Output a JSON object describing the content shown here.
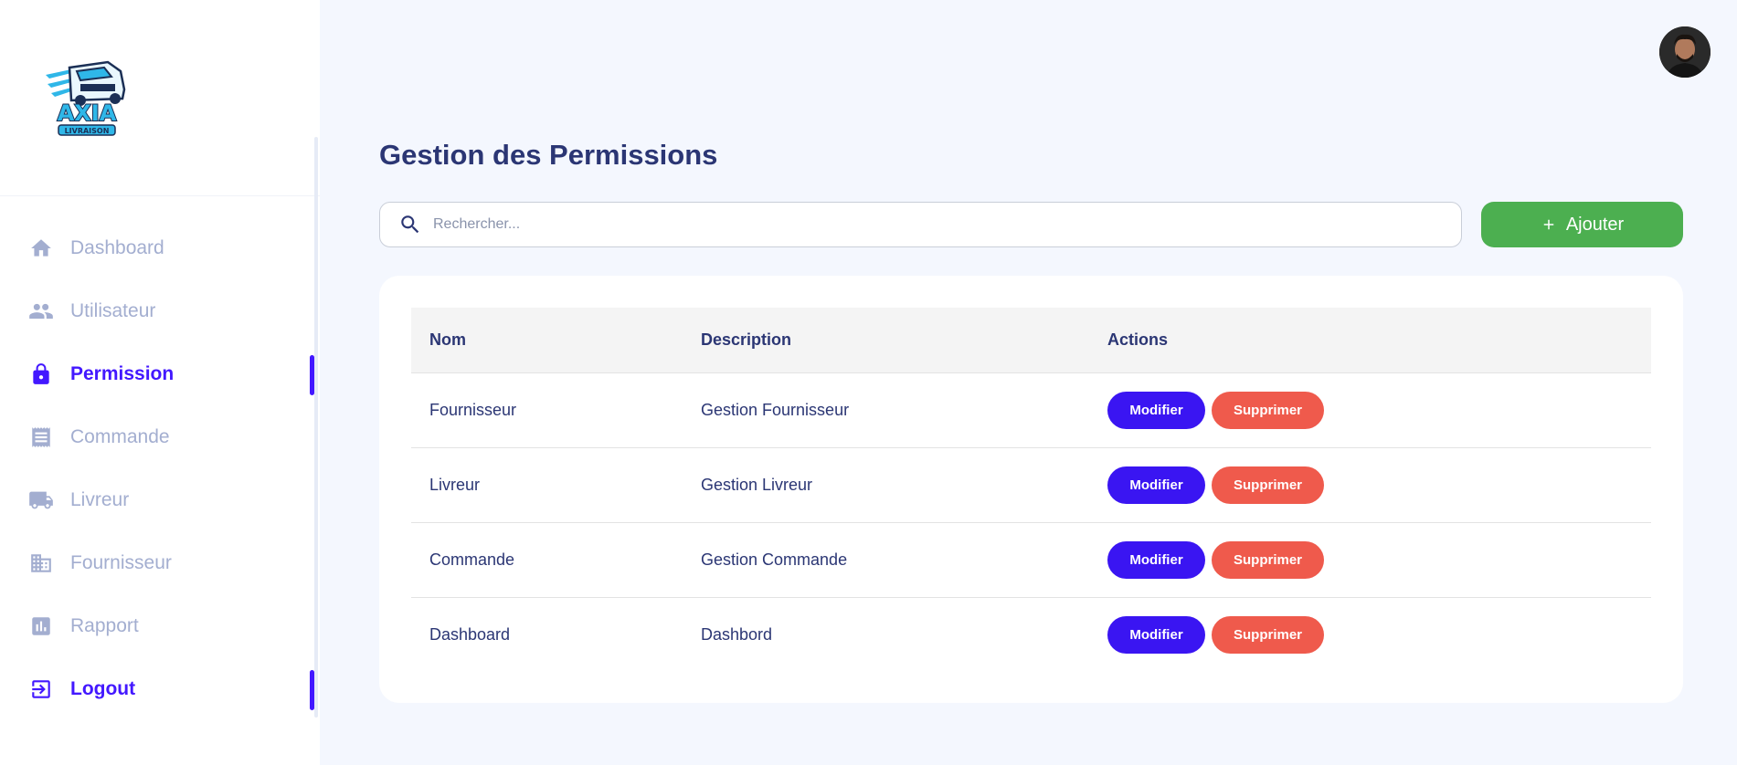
{
  "brand": {
    "logo_text": "AXIA",
    "logo_subtext": "LIVRAISON"
  },
  "sidebar": {
    "items": [
      {
        "label": "Dashboard",
        "icon": "home-icon",
        "active": false
      },
      {
        "label": "Utilisateur",
        "icon": "users-icon",
        "active": false
      },
      {
        "label": "Permission",
        "icon": "lock-icon",
        "active": true
      },
      {
        "label": "Commande",
        "icon": "receipt-icon",
        "active": false
      },
      {
        "label": "Livreur",
        "icon": "truck-icon",
        "active": false
      },
      {
        "label": "Fournisseur",
        "icon": "building-icon",
        "active": false
      },
      {
        "label": "Rapport",
        "icon": "bar-chart-icon",
        "active": false
      },
      {
        "label": "Logout",
        "icon": "logout-icon",
        "active": true
      }
    ]
  },
  "header": {
    "avatar_icon": "user-avatar"
  },
  "main": {
    "title": "Gestion des Permissions",
    "search": {
      "placeholder": "Rechercher...",
      "value": "",
      "icon": "search-icon"
    },
    "add_button": {
      "label": "Ajouter",
      "icon": "plus-icon"
    },
    "table": {
      "columns": [
        "Nom",
        "Description",
        "Actions"
      ],
      "rows": [
        {
          "nom": "Fournisseur",
          "description": "Gestion Fournisseur"
        },
        {
          "nom": "Livreur",
          "description": "Gestion Livreur"
        },
        {
          "nom": "Commande",
          "description": "Gestion Commande"
        },
        {
          "nom": "Dashboard",
          "description": "Dashbord"
        }
      ],
      "edit_label": "Modifier",
      "delete_label": "Supprimer"
    }
  },
  "colors": {
    "accent": "#4318ff",
    "inactive_nav": "#a3aed0",
    "text": "#2b3674",
    "add_button": "#4caf50",
    "edit_button": "#3a15f2",
    "delete_button": "#ef5a4c",
    "background": "#f4f7fe"
  }
}
